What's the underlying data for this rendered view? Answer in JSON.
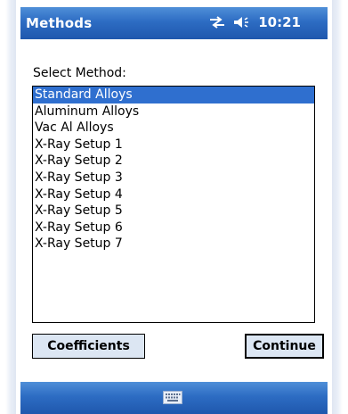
{
  "window": {
    "title": "Methods",
    "time": "10:21"
  },
  "icons": {
    "connectivity": "connectivity-icon",
    "volume": "speaker-icon",
    "keyboard": "keyboard-icon"
  },
  "content": {
    "select_label": "Select Method:"
  },
  "methods_list": {
    "selected_index": 0,
    "items": [
      "Standard Alloys",
      "Aluminum Alloys",
      "Vac Al Alloys",
      "X-Ray Setup 1",
      "X-Ray Setup 2",
      "X-Ray Setup 3",
      "X-Ray Setup 4",
      "X-Ray Setup 5",
      "X-Ray Setup 6",
      "X-Ray Setup 7"
    ]
  },
  "buttons": {
    "coefficients": "Coefficients",
    "continue": "Continue"
  },
  "colors": {
    "titlebar": "#2d6cc3",
    "selection": "#2f6fcf",
    "button_face": "#dce6f3"
  }
}
